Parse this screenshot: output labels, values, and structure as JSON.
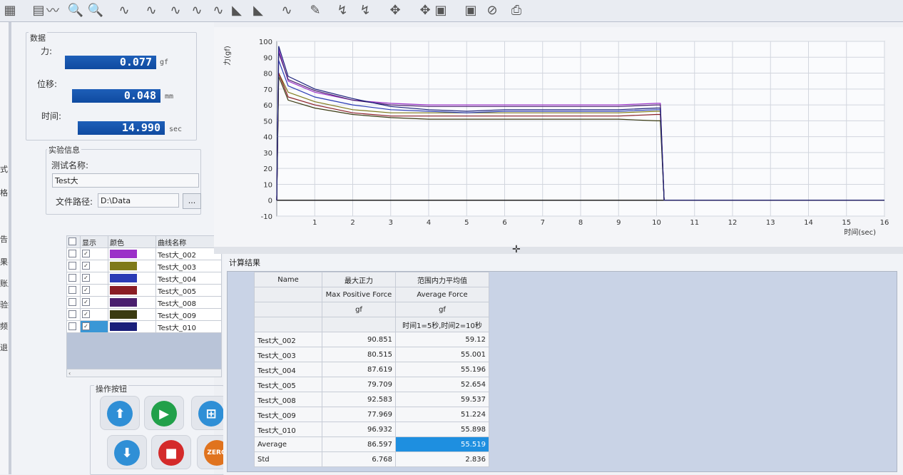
{
  "toolbar_icons": [
    "table-icon",
    "grid-table-icon",
    "chart-icon",
    "zoom-in-icon",
    "zoom-out-icon",
    "wave-icon-1",
    "wave-icon-2",
    "wave-icon-3",
    "wave-icon-4",
    "wave-icon-5",
    "wave-icon-6",
    "wave-icon-7",
    "wave-icon-8",
    "tool-icon-1",
    "tool-icon-2",
    "tool-icon-3",
    "tool-icon-4",
    "tool-icon-5",
    "tool-icon-6",
    "tool-icon-7",
    "stop-sign-icon",
    "print-icon"
  ],
  "left_nav": {
    "items": [
      "式",
      "格",
      "告",
      "果导出",
      "账户设置",
      "验报告",
      "频",
      "退出"
    ]
  },
  "data_panel": {
    "title": "数据",
    "force_label": "力:",
    "force_value": "0.077",
    "force_unit": "gf",
    "disp_label": "位移:",
    "disp_value": "0.048",
    "disp_unit": "mm",
    "time_label": "时间:",
    "time_value": "14.990",
    "time_unit": "sec"
  },
  "exp_info": {
    "title": "实验信息",
    "name_label": "测试名称:",
    "name_value": "Test大",
    "path_label": "文件路径:",
    "path_value": "D:\\Data",
    "browse_label": "..."
  },
  "curve_table": {
    "headers": [
      "显示",
      "颜色",
      "曲线名称"
    ],
    "rows": [
      {
        "name": "Test大_002",
        "color": "#9b30c8"
      },
      {
        "name": "Test大_003",
        "color": "#7f7a1a"
      },
      {
        "name": "Test大_004",
        "color": "#2a3bb5"
      },
      {
        "name": "Test大_005",
        "color": "#8a1d24"
      },
      {
        "name": "Test大_008",
        "color": "#4a1f6e"
      },
      {
        "name": "Test大_009",
        "color": "#3b3b12"
      },
      {
        "name": "Test大_010",
        "color": "#1a1f7a"
      }
    ]
  },
  "op_buttons": {
    "title": "操作按钮",
    "zero_label": "ZERO"
  },
  "chart_data": {
    "type": "line",
    "ylabel": "力(gf)",
    "xlabel": "时间(sec)",
    "xlim": [
      0,
      16
    ],
    "ylim": [
      -10,
      100
    ],
    "xticks": [
      1,
      2,
      3,
      4,
      5,
      6,
      7,
      8,
      9,
      10,
      11,
      12,
      13,
      14,
      15,
      16
    ],
    "yticks": [
      -10,
      0,
      10,
      20,
      30,
      40,
      50,
      60,
      70,
      80,
      90,
      100
    ],
    "grid": true,
    "series": [
      {
        "color": "#9b30c8",
        "points": [
          [
            0,
            0
          ],
          [
            0.05,
            95
          ],
          [
            0.3,
            75
          ],
          [
            1,
            68
          ],
          [
            2,
            63
          ],
          [
            3,
            61
          ],
          [
            4,
            60
          ],
          [
            5,
            60
          ],
          [
            6,
            60
          ],
          [
            7,
            60
          ],
          [
            8,
            60
          ],
          [
            9,
            60
          ],
          [
            10,
            61
          ],
          [
            10.1,
            61
          ],
          [
            10.2,
            0
          ],
          [
            16,
            0
          ]
        ]
      },
      {
        "color": "#7f7a1a",
        "points": [
          [
            0,
            0
          ],
          [
            0.05,
            80
          ],
          [
            0.3,
            68
          ],
          [
            1,
            62
          ],
          [
            2,
            57
          ],
          [
            3,
            55
          ],
          [
            4,
            55
          ],
          [
            5,
            55
          ],
          [
            6,
            55
          ],
          [
            7,
            55
          ],
          [
            8,
            55
          ],
          [
            9,
            55
          ],
          [
            10,
            56
          ],
          [
            10.1,
            56
          ],
          [
            10.2,
            0
          ],
          [
            16,
            0
          ]
        ]
      },
      {
        "color": "#2a3bb5",
        "points": [
          [
            0,
            0
          ],
          [
            0.05,
            88
          ],
          [
            0.3,
            72
          ],
          [
            1,
            65
          ],
          [
            2,
            60
          ],
          [
            3,
            57
          ],
          [
            4,
            56
          ],
          [
            5,
            55
          ],
          [
            6,
            56
          ],
          [
            7,
            56
          ],
          [
            8,
            56
          ],
          [
            9,
            56
          ],
          [
            10,
            57
          ],
          [
            10.1,
            57
          ],
          [
            10.2,
            0
          ],
          [
            16,
            0
          ]
        ]
      },
      {
        "color": "#8a1d24",
        "points": [
          [
            0,
            0
          ],
          [
            0.05,
            80
          ],
          [
            0.3,
            65
          ],
          [
            1,
            60
          ],
          [
            2,
            55
          ],
          [
            3,
            53
          ],
          [
            4,
            53
          ],
          [
            5,
            53
          ],
          [
            6,
            53
          ],
          [
            7,
            53
          ],
          [
            8,
            53
          ],
          [
            9,
            53
          ],
          [
            10,
            54
          ],
          [
            10.1,
            54
          ],
          [
            10.2,
            0
          ],
          [
            16,
            0
          ]
        ]
      },
      {
        "color": "#4a1f6e",
        "points": [
          [
            0,
            0
          ],
          [
            0.05,
            93
          ],
          [
            0.3,
            76
          ],
          [
            1,
            69
          ],
          [
            2,
            63
          ],
          [
            3,
            60
          ],
          [
            4,
            59
          ],
          [
            5,
            59
          ],
          [
            6,
            59
          ],
          [
            7,
            59
          ],
          [
            8,
            59
          ],
          [
            9,
            59
          ],
          [
            10,
            60
          ],
          [
            10.1,
            60
          ],
          [
            10.2,
            0
          ],
          [
            16,
            0
          ]
        ]
      },
      {
        "color": "#3b3b12",
        "points": [
          [
            0,
            0
          ],
          [
            0.05,
            78
          ],
          [
            0.3,
            63
          ],
          [
            1,
            58
          ],
          [
            2,
            54
          ],
          [
            3,
            52
          ],
          [
            4,
            51
          ],
          [
            5,
            51
          ],
          [
            6,
            51
          ],
          [
            7,
            51
          ],
          [
            8,
            51
          ],
          [
            9,
            51
          ],
          [
            10,
            50
          ],
          [
            10.1,
            50
          ],
          [
            10.2,
            0
          ],
          [
            16,
            0
          ]
        ]
      },
      {
        "color": "#1a1f7a",
        "points": [
          [
            0,
            0
          ],
          [
            0.05,
            97
          ],
          [
            0.3,
            78
          ],
          [
            1,
            70
          ],
          [
            2,
            64
          ],
          [
            3,
            59
          ],
          [
            4,
            57
          ],
          [
            5,
            56
          ],
          [
            6,
            57
          ],
          [
            7,
            57
          ],
          [
            8,
            57
          ],
          [
            9,
            57
          ],
          [
            10,
            58
          ],
          [
            10.1,
            58
          ],
          [
            10.2,
            0
          ],
          [
            16,
            0
          ]
        ]
      }
    ]
  },
  "results": {
    "title": "计算结果",
    "col_name": "Name",
    "col1_cn": "最大正力",
    "col1_en": "Max Positive Force",
    "col1_unit": "gf",
    "col2_cn": "范围内力平均值",
    "col2_en": "Average Force",
    "col2_unit": "gf",
    "col2_range": "时间1=5秒,时间2=10秒",
    "rows": [
      {
        "name": "Test大_002",
        "max": "90.851",
        "avg": "59.12"
      },
      {
        "name": "Test大_003",
        "max": "80.515",
        "avg": "55.001"
      },
      {
        "name": "Test大_004",
        "max": "87.619",
        "avg": "55.196"
      },
      {
        "name": "Test大_005",
        "max": "79.709",
        "avg": "52.654"
      },
      {
        "name": "Test大_008",
        "max": "92.583",
        "avg": "59.537"
      },
      {
        "name": "Test大_009",
        "max": "77.969",
        "avg": "51.224"
      },
      {
        "name": "Test大_010",
        "max": "96.932",
        "avg": "55.898"
      },
      {
        "name": "Average",
        "max": "86.597",
        "avg": "55.519"
      },
      {
        "name": "Std",
        "max": "6.768",
        "avg": "2.836"
      }
    ]
  }
}
